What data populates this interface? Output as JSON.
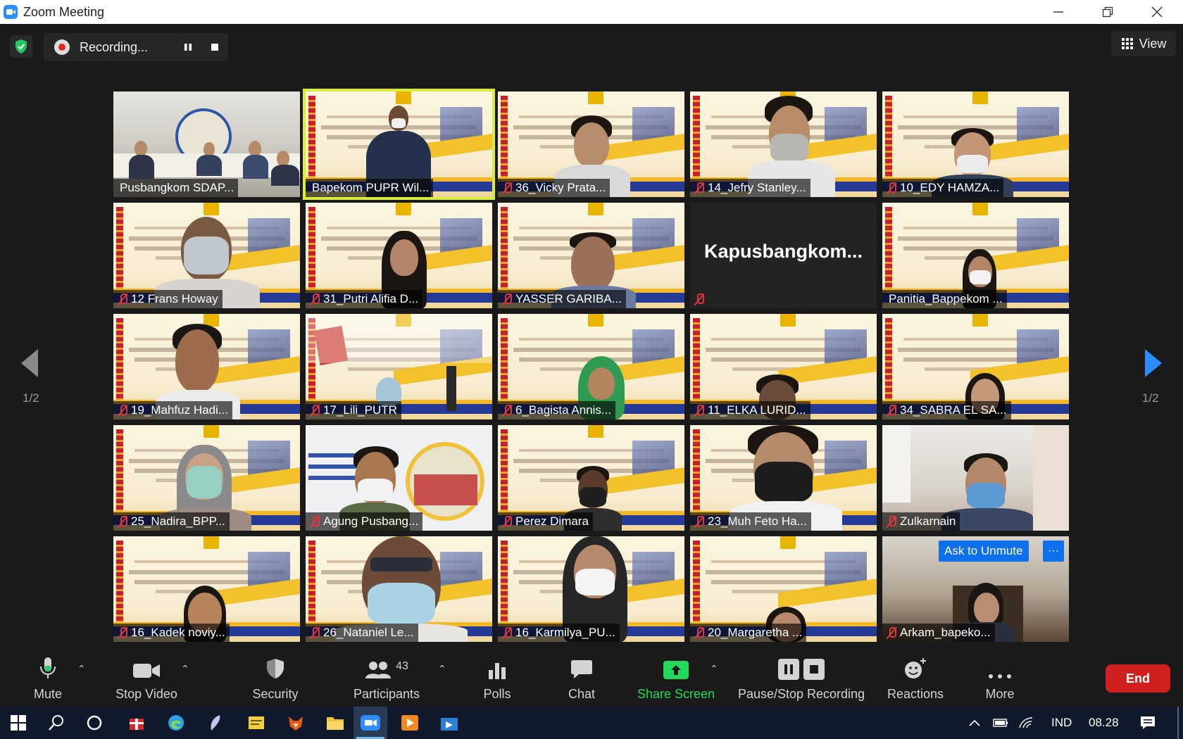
{
  "window": {
    "title": "Zoom Meeting"
  },
  "recording": {
    "status": "Recording..."
  },
  "view_button": {
    "label": "View"
  },
  "pagination": {
    "left": "1/2",
    "right": "1/2"
  },
  "participants": [
    {
      "name": "Pusbangkom SDAP...",
      "muted": false
    },
    {
      "name": "Bapekom PUPR Wil...",
      "muted": false
    },
    {
      "name": "36_Vicky Prata...",
      "muted": true
    },
    {
      "name": "14_Jefry Stanley...",
      "muted": true
    },
    {
      "name": "10_EDY HAMZA...",
      "muted": true
    },
    {
      "name": "12 Frans Howay",
      "muted": true
    },
    {
      "name": "31_Putri Alifia D...",
      "muted": true
    },
    {
      "name": "YASSER GARIBA...",
      "muted": true
    },
    {
      "name": "Kapusbangkom...",
      "muted": true
    },
    {
      "name": "Panitia_Bappekom ...",
      "muted": false
    },
    {
      "name": "19_Mahfuz Hadi...",
      "muted": true
    },
    {
      "name": "17_Lili_PUTR",
      "muted": true
    },
    {
      "name": "6_Bagista Annis...",
      "muted": true
    },
    {
      "name": "11_ELKA LURID...",
      "muted": true
    },
    {
      "name": "34_SABRA EL SA...",
      "muted": true
    },
    {
      "name": "25_Nadira_BPP...",
      "muted": true
    },
    {
      "name": "Agung Pusbang...",
      "muted": true
    },
    {
      "name": "Perez Dimara",
      "muted": true
    },
    {
      "name": "23_Muh Feto Ha...",
      "muted": true
    },
    {
      "name": "Zulkarnain",
      "muted": true
    },
    {
      "name": "16_Kadek noviy...",
      "muted": true
    },
    {
      "name": "26_Nataniel Le...",
      "muted": true
    },
    {
      "name": "16_Karmilya_PU...",
      "muted": true
    },
    {
      "name": "20_Margaretha ...",
      "muted": true
    },
    {
      "name": "Arkam_bapeko...",
      "muted": true
    }
  ],
  "tile_actions": {
    "ask_to_unmute": "Ask to Unmute",
    "more": "···"
  },
  "toolbar": {
    "mute": "Mute",
    "stop_video": "Stop Video",
    "security": "Security",
    "participants": "Participants",
    "participants_count": "43",
    "polls": "Polls",
    "chat": "Chat",
    "share_screen": "Share Screen",
    "pause_stop_recording": "Pause/Stop Recording",
    "reactions": "Reactions",
    "more": "More",
    "end": "End"
  },
  "taskbar": {
    "language": "IND",
    "time": "08.28"
  },
  "colors": {
    "accent_blue": "#0e71eb",
    "share_green": "#23d959",
    "end_red": "#d01f1f",
    "mute_red": "#e0363c",
    "active_speaker": "#d8ee3a"
  }
}
